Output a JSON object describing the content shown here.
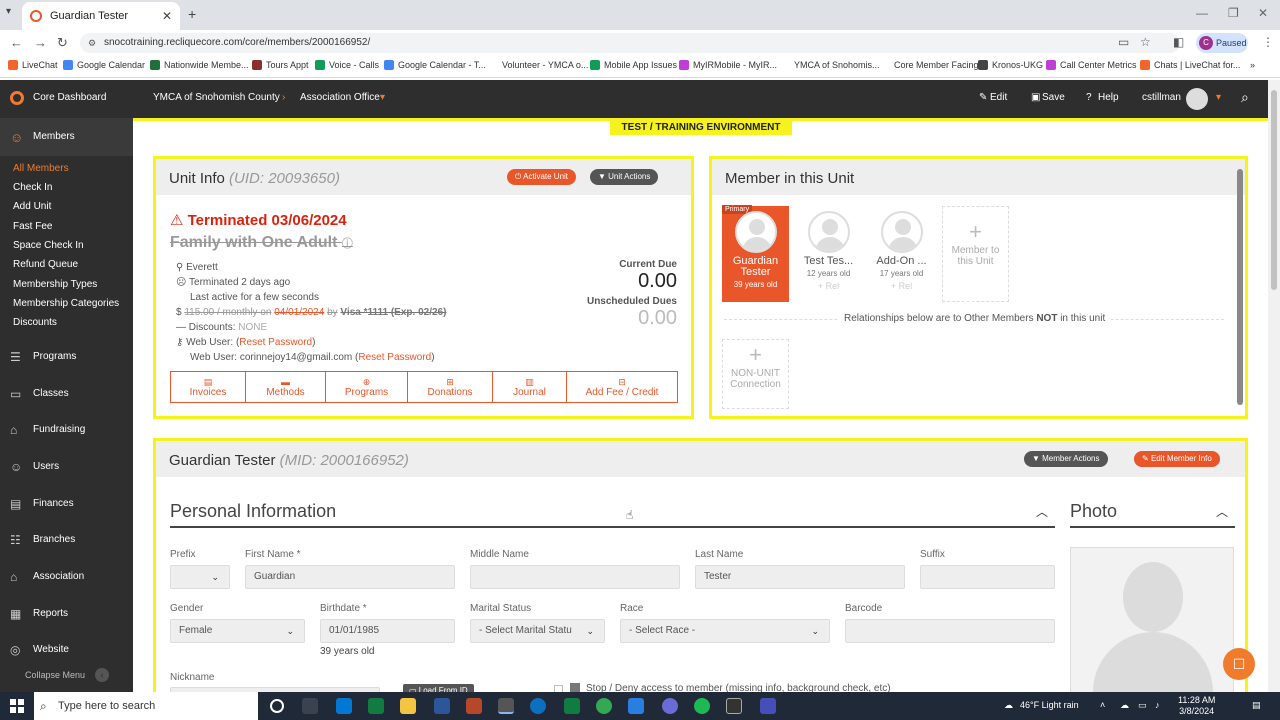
{
  "browser": {
    "tab_title": "Guardian Tester",
    "url": "snocotraining.recliquecore.com/core/members/2000166952/",
    "profile_status": "Paused",
    "profile_initial": "C",
    "bookmarks": [
      {
        "label": "LiveChat",
        "color": "#f0662c"
      },
      {
        "label": "Google Calendar",
        "color": "#4285f4"
      },
      {
        "label": "Nationwide Membe...",
        "color": "#1f6f3a"
      },
      {
        "label": "Tours Appt",
        "color": "#8b2d2d"
      },
      {
        "label": "Voice - Calls",
        "color": "#0f9d58"
      },
      {
        "label": "Google Calendar - T...",
        "color": "#4285f4"
      },
      {
        "label": "Volunteer - YMCA o...",
        "color": "#ffffff"
      },
      {
        "label": "Mobile App Issues",
        "color": "#0f9d58"
      },
      {
        "label": "MyIRMobile - MyIR...",
        "color": "#c03ed6"
      },
      {
        "label": "YMCA of Snohomis...",
        "color": "#ffffff"
      },
      {
        "label": "Core Member Facing",
        "color": "#ffffff"
      },
      {
        "label": "Kronos-UKG",
        "color": "#444444"
      },
      {
        "label": "Call Center Metrics",
        "color": "#c03ed6"
      },
      {
        "label": "Chats | LiveChat for...",
        "color": "#f0662c"
      }
    ]
  },
  "header": {
    "brand": "Core Dashboard",
    "org": "YMCA of Snohomish County",
    "office": "Association Office",
    "edit": "Edit",
    "save": "Save",
    "help": "Help",
    "user": "cstillman"
  },
  "sidebar": {
    "section": "Members",
    "sub_items": [
      "All Members",
      "Check In",
      "Add Unit",
      "Fast Fee",
      "Space Check In",
      "Refund Queue",
      "Membership Types",
      "Membership Categories",
      "Discounts"
    ],
    "sections": [
      "Programs",
      "Classes",
      "Fundraising",
      "Users",
      "Finances",
      "Branches",
      "Association",
      "Reports",
      "Website"
    ],
    "collapse": "Collapse Menu"
  },
  "env_banner": "TEST / TRAINING ENVIRONMENT",
  "unit": {
    "title": "Unit Info",
    "uid": "(UID: 20093650)",
    "activate_btn": "Activate Unit",
    "actions_btn": "Unit Actions",
    "status": "Terminated 03/06/2024",
    "name": "Family with One Adult",
    "location": "Everett",
    "terminated_ago": "Terminated 2 days ago",
    "last_active": "Last active for a few seconds",
    "payment_struck": "115.00 / monthly on",
    "payment_date": "04/01/2024",
    "payment_by": "by",
    "payment_card": "Visa *1111 (Exp. 02/26)",
    "discounts_label": "Discounts:",
    "discounts_value": "NONE",
    "web_user_label": "Web User:",
    "reset_password": "Reset Password",
    "web_user2_label": "Web User: corinnejoy14@gmail.com",
    "current_due_label": "Current Due",
    "current_due": "0.00",
    "unscheduled_label": "Unscheduled Dues",
    "unscheduled": "0.00",
    "actions": [
      "Invoices",
      "Methods",
      "Programs",
      "Donations",
      "Journal",
      "Add Fee / Credit"
    ]
  },
  "members_panel": {
    "title": "Member in this Unit",
    "primary_badge": "Primary",
    "members": [
      {
        "name": "Guardian Tester",
        "age": "39 years old",
        "rel": ""
      },
      {
        "name": "Test Tes...",
        "age": "12 years old",
        "rel": "+ Rel"
      },
      {
        "name": "Add-On ...",
        "age": "17 years old",
        "rel": "+ Rel"
      }
    ],
    "add_member": "Member to this Unit",
    "relationships_note_pre": "Relationships below are to Other Members",
    "relationships_note_not": "NOT",
    "relationships_note_post": "in this unit",
    "non_unit": "NON-UNIT Connection"
  },
  "member": {
    "name": "Guardian Tester",
    "mid": "(MID: 2000166952)",
    "member_actions_btn": "Member Actions",
    "edit_btn": "Edit Member Info",
    "personal_info": "Personal Information",
    "photo": "Photo",
    "fields": {
      "prefix_label": "Prefix",
      "first_name_label": "First Name *",
      "first_name": "Guardian",
      "middle_name_label": "Middle Name",
      "last_name_label": "Last Name",
      "last_name": "Tester",
      "suffix_label": "Suffix",
      "gender_label": "Gender",
      "gender": "Female",
      "birthdate_label": "Birthdate *",
      "birthdate": "01/01/1985",
      "age_note": "39 years old",
      "marital_label": "Marital Status",
      "marital": "- Select Marital Statu",
      "race_label": "Race",
      "race": "- Select Race -",
      "barcode_label": "Barcode",
      "nickname_label": "Nickname",
      "load_from_id": "Load From ID",
      "stop_deny": "Stop / Deny access to member (missing info, background check, etc)"
    }
  },
  "taskbar": {
    "search_placeholder": "Type here to search",
    "weather": "46°F  Light rain",
    "time": "11:28 AM",
    "date": "3/8/2024"
  },
  "colors": {
    "accent": "#e8562a",
    "highlight": "#f6f21d",
    "dark": "#2e2e2e"
  }
}
